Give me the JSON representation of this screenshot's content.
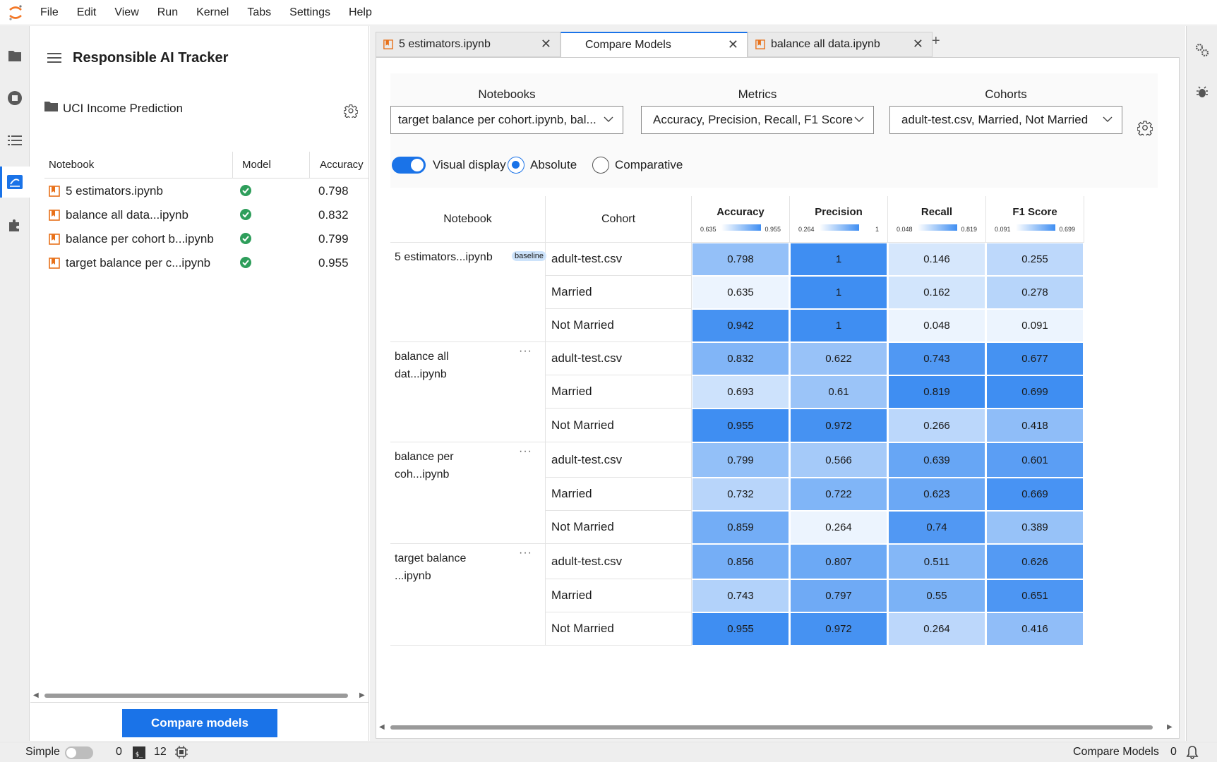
{
  "menu": [
    "File",
    "Edit",
    "View",
    "Run",
    "Kernel",
    "Tabs",
    "Settings",
    "Help"
  ],
  "panel": {
    "title": "Responsible AI Tracker",
    "project": "UCI Income Prediction",
    "columns": [
      "Notebook",
      "Model",
      "Accuracy"
    ],
    "notebooks": [
      {
        "name": "5 estimators.ipynb",
        "accuracy": "0.798"
      },
      {
        "name": "balance all data...ipynb",
        "accuracy": "0.832"
      },
      {
        "name": "balance per cohort b...ipynb",
        "accuracy": "0.799"
      },
      {
        "name": "target balance per c...ipynb",
        "accuracy": "0.955"
      }
    ],
    "compare_button": "Compare models"
  },
  "tabs": [
    {
      "label": "5 estimators.ipynb",
      "icon": "notebook-icon"
    },
    {
      "label": "Compare Models",
      "icon": ""
    },
    {
      "label": "balance all data.ipynb",
      "icon": "notebook-icon"
    }
  ],
  "tab_close": "✕",
  "tab_add": "+",
  "filters": {
    "notebooks": {
      "label": "Notebooks",
      "value": "target balance per cohort.ipynb, bal..."
    },
    "metrics": {
      "label": "Metrics",
      "value": "Accuracy, Precision, Recall, F1 Score"
    },
    "cohorts": {
      "label": "Cohorts",
      "value": "adult-test.csv, Married, Not Married"
    }
  },
  "display": {
    "visual_label": "Visual display",
    "absolute_label": "Absolute",
    "comparative_label": "Comparative",
    "visual_on": true,
    "mode": "absolute"
  },
  "grid": {
    "headers": {
      "notebook": "Notebook",
      "cohort": "Cohort"
    },
    "metrics": [
      {
        "label": "Accuracy",
        "min": "0.635",
        "max": "0.955"
      },
      {
        "label": "Precision",
        "min": "0.264",
        "max": "1"
      },
      {
        "label": "Recall",
        "min": "0.048",
        "max": "0.819"
      },
      {
        "label": "F1 Score",
        "min": "0.091",
        "max": "0.699"
      }
    ],
    "cohorts": [
      "adult-test.csv",
      "Married",
      "Not Married"
    ],
    "baseline_label": "baseline",
    "more_label": "···",
    "groups": [
      {
        "name": "5 estimators...ipynb",
        "baseline": true,
        "rows": [
          [
            "0.798",
            "1",
            "0.146",
            "0.255"
          ],
          [
            "0.635",
            "1",
            "0.162",
            "0.278"
          ],
          [
            "0.942",
            "1",
            "0.048",
            "0.091"
          ]
        ]
      },
      {
        "name": "balance all dat...ipynb",
        "baseline": false,
        "rows": [
          [
            "0.832",
            "0.622",
            "0.743",
            "0.677"
          ],
          [
            "0.693",
            "0.61",
            "0.819",
            "0.699"
          ],
          [
            "0.955",
            "0.972",
            "0.266",
            "0.418"
          ]
        ]
      },
      {
        "name": "balance per coh...ipynb",
        "baseline": false,
        "rows": [
          [
            "0.799",
            "0.566",
            "0.639",
            "0.601"
          ],
          [
            "0.732",
            "0.722",
            "0.623",
            "0.669"
          ],
          [
            "0.859",
            "0.264",
            "0.74",
            "0.389"
          ]
        ]
      },
      {
        "name": "target balance ...ipynb",
        "baseline": false,
        "rows": [
          [
            "0.856",
            "0.807",
            "0.511",
            "0.626"
          ],
          [
            "0.743",
            "0.797",
            "0.55",
            "0.651"
          ],
          [
            "0.955",
            "0.972",
            "0.264",
            "0.416"
          ]
        ]
      }
    ]
  },
  "status": {
    "mode": "Simple",
    "kernels": "0",
    "terminals": "12",
    "right_label": "Compare Models",
    "right_count": "0"
  },
  "colors": {
    "accent": "#1a73e8",
    "notebook_icon": "#e8711a",
    "check": "#2e9e5b"
  }
}
